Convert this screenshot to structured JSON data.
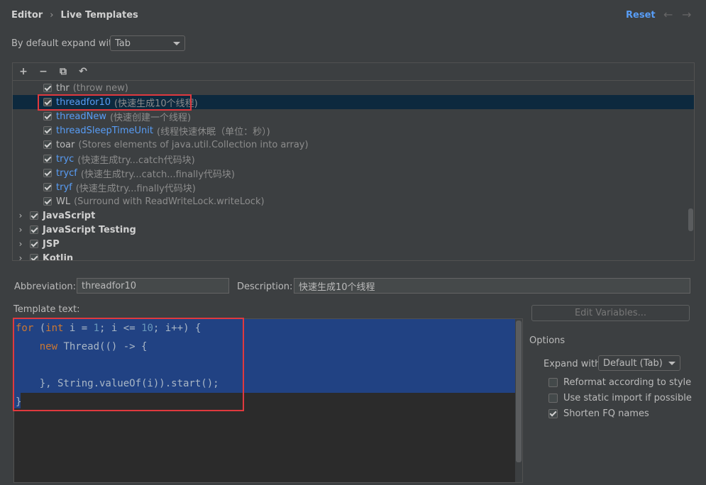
{
  "header": {
    "breadcrumb": [
      "Editor",
      "Live Templates"
    ],
    "reset_label": "Reset",
    "back_glyph": "←",
    "forward_glyph": "→"
  },
  "expand": {
    "label": "By default expand with",
    "value": "Tab"
  },
  "toolbar": {
    "add_glyph": "+",
    "remove_glyph": "−",
    "copy_glyph": "⧉",
    "revert_glyph": "↶"
  },
  "templates": [
    {
      "name": "thr",
      "desc": "(throw new)",
      "checked": true,
      "link": false
    },
    {
      "name": "threadfor10",
      "desc": "(快速生成10个线程)",
      "checked": true,
      "link": true,
      "selected": true
    },
    {
      "name": "threadNew",
      "desc": "(快速创建一个线程)",
      "checked": true,
      "link": true
    },
    {
      "name": "threadSleepTimeUnit",
      "desc": "(线程快速休眠（单位：秒）)",
      "checked": true,
      "link": true
    },
    {
      "name": "toar",
      "desc": "(Stores elements of java.util.Collection into array)",
      "checked": true,
      "link": false
    },
    {
      "name": "tryc",
      "desc": "(快速生成try...catch代码块)",
      "checked": true,
      "link": true
    },
    {
      "name": "trycf",
      "desc": "(快速生成try...catch...finally代码块)",
      "checked": true,
      "link": true
    },
    {
      "name": "tryf",
      "desc": "(快速生成try...finally代码块)",
      "checked": true,
      "link": true
    },
    {
      "name": "WL",
      "desc": "(Surround with ReadWriteLock.writeLock)",
      "checked": true,
      "link": false
    }
  ],
  "groups": [
    {
      "name": "JavaScript",
      "checked": true
    },
    {
      "name": "JavaScript Testing",
      "checked": true
    },
    {
      "name": "JSP",
      "checked": true
    },
    {
      "name": "Kotlin",
      "checked": true
    }
  ],
  "abbreviation": {
    "label": "Abbreviation:",
    "value": "threadfor10"
  },
  "description": {
    "label": "Description:",
    "value": "快速生成10个线程"
  },
  "template_text_label": "Template text:",
  "code": {
    "line1": {
      "for": "for",
      "p1": " (",
      "int": "int",
      "p2": " i = ",
      "n1": "1",
      "p3": "; i <= ",
      "n2": "10",
      "p4": "; i++) {"
    },
    "line2": {
      "indent": "    ",
      "new": "new",
      "rest": " Thread(() -> {"
    },
    "line3": "",
    "line4": "    }, String.valueOf(i)).start();",
    "line5": "}"
  },
  "edit_variables_label": "Edit Variables...",
  "options": {
    "title": "Options",
    "expand_label": "Expand with",
    "expand_value": "Default (Tab)",
    "items": [
      {
        "label": "Reformat according to style",
        "checked": false
      },
      {
        "label": "Use static import if possible",
        "checked": false
      },
      {
        "label": "Shorten FQ names",
        "checked": true
      }
    ]
  }
}
